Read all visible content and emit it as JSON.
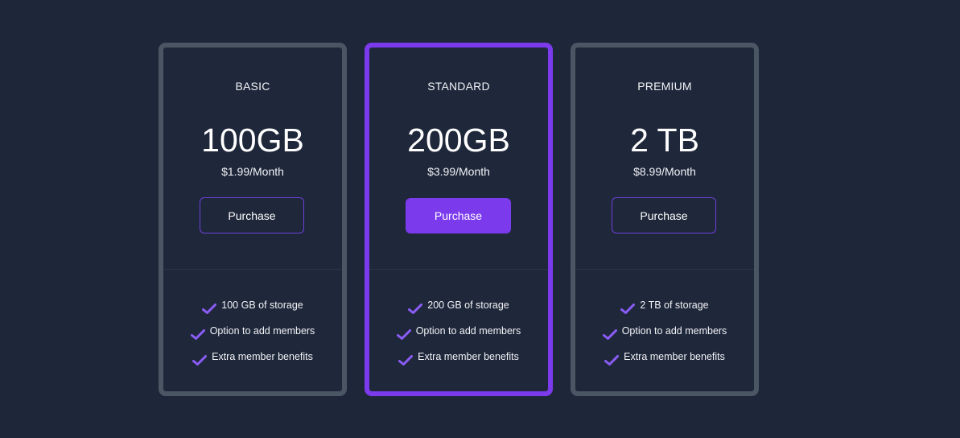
{
  "plans": [
    {
      "tier": "BASIC",
      "size": "100GB",
      "price": "$1.99/Month",
      "button_label": "Purchase",
      "features": [
        "100 GB of storage",
        "Option to add members",
        "Extra member benefits"
      ]
    },
    {
      "tier": "STANDARD",
      "size": "200GB",
      "price": "$3.99/Month",
      "button_label": "Purchase",
      "features": [
        "200 GB of storage",
        "Option to add members",
        "Extra member benefits"
      ]
    },
    {
      "tier": "PREMIUM",
      "size": "2 TB",
      "price": "$8.99/Month",
      "button_label": "Purchase",
      "features": [
        "2 TB of storage",
        "Option to add members",
        "Extra member benefits"
      ]
    }
  ],
  "featured_plan": "STANDARD",
  "colors": {
    "background": "#1e273a",
    "card_border": "#4b5665",
    "accent": "#7c3aed",
    "check": "#8b5cf6"
  },
  "icons": {
    "feature": "check-icon"
  }
}
